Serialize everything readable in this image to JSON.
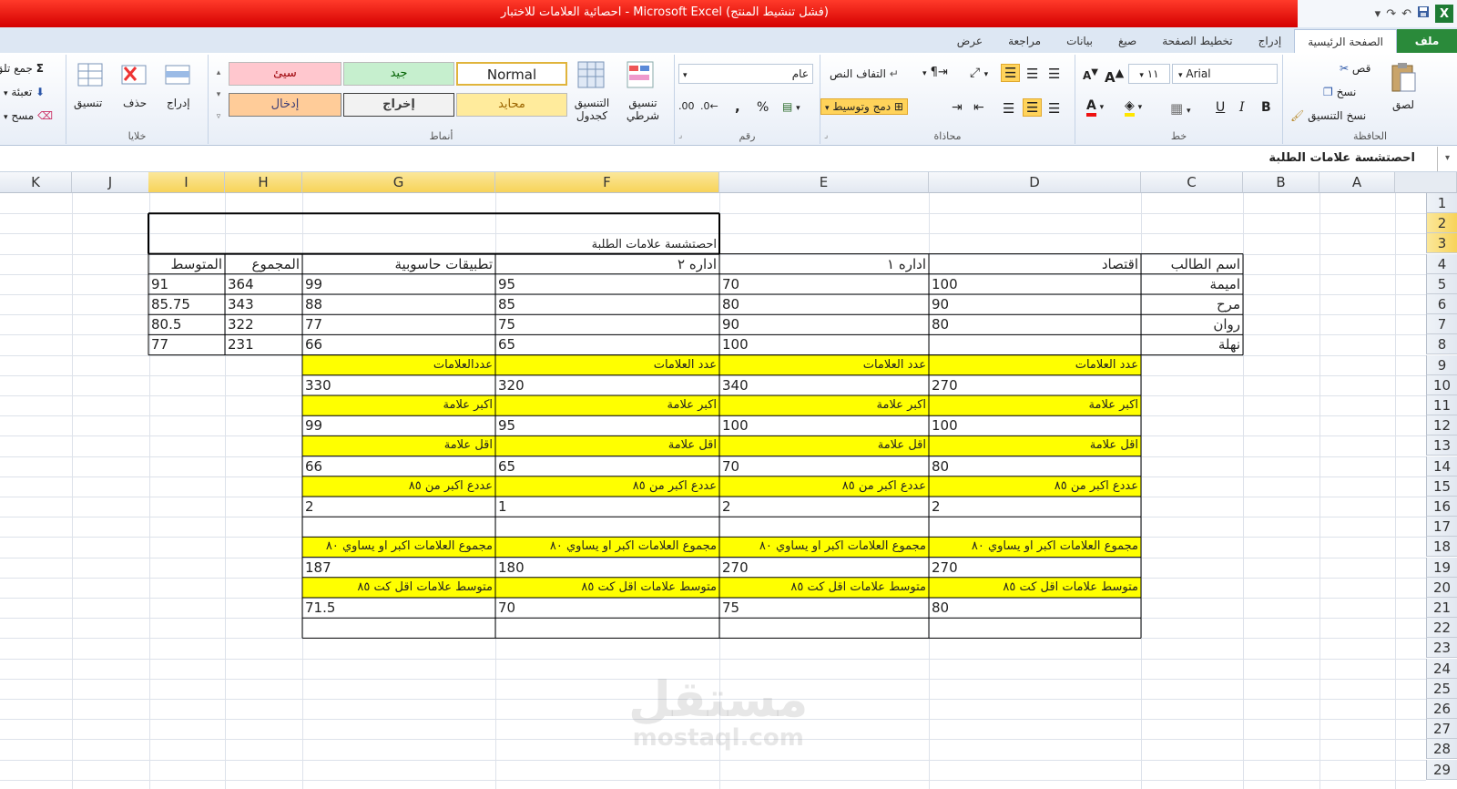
{
  "window": {
    "title": "احصائية العلامات للاختبار - Microsoft Excel (فشل تنشيط المنتج)",
    "qat_icons": [
      "excel-logo-icon",
      "save-icon",
      "undo-icon",
      "redo-icon",
      "customize-qat-icon"
    ]
  },
  "tabs": [
    {
      "label": "ملف"
    },
    {
      "label": "الصفحة الرئيسية"
    },
    {
      "label": "إدراج"
    },
    {
      "label": "تخطيط الصفحة"
    },
    {
      "label": "صيغ"
    },
    {
      "label": "بيانات"
    },
    {
      "label": "مراجعة"
    },
    {
      "label": "عرض"
    }
  ],
  "ribbon": {
    "clipboard": {
      "paste": "لصق",
      "cut": "قص",
      "copy": "نسخ",
      "format_painter": "نسخ التنسيق",
      "label": "الحافظة"
    },
    "font": {
      "name": "Arial",
      "size": "١١",
      "bold": "B",
      "italic": "I",
      "underline": "U",
      "grow": "A",
      "shrink": "A",
      "label": "خط"
    },
    "alignment": {
      "wrap": "التفاف النص",
      "merge": "دمج وتوسيط",
      "label": "محاذاة"
    },
    "number": {
      "format": "عام",
      "percent": "%",
      "comma": ",",
      "label": "رقم"
    },
    "styles": {
      "conditional": "تنسيق شرطي",
      "as_table": "التنسيق كجدول",
      "normal": "Normal",
      "good": "جيد",
      "bad": "سيئ",
      "neutral": "محايد",
      "output": "إخراج",
      "input": "إدخال",
      "label": "أنماط"
    },
    "cells": {
      "insert": "إدراج",
      "delete": "حذف",
      "format": "تنسيق",
      "label": "خلايا"
    },
    "editing": {
      "autosum": "جمع تلق",
      "fill": "تعبئة",
      "clear": "مسح"
    }
  },
  "formula_bar": {
    "content": "احصتشسة علامات الطلبة"
  },
  "columns": [
    "K",
    "J",
    "I",
    "H",
    "G",
    "F",
    "E",
    "D",
    "C",
    "B",
    "A"
  ],
  "rows": [
    "1",
    "2",
    "3",
    "4",
    "5",
    "6",
    "7",
    "8",
    "9",
    "10",
    "11",
    "12",
    "13",
    "14",
    "15",
    "16",
    "17",
    "18",
    "19",
    "20",
    "21",
    "22",
    "23",
    "24",
    "25",
    "26",
    "27",
    "28",
    "29"
  ],
  "sheet": {
    "title": "احصتشسة علامات الطلبة",
    "headers": {
      "student": "اسم الطالب",
      "econ": "اقتصاد",
      "admin1": "اداره ١",
      "admin2": "اداره ٢",
      "apps": "تطبيقات حاسوبية",
      "total": "المجموع",
      "avg": "المتوسط"
    },
    "students": [
      {
        "name": "اميمة",
        "econ": "100",
        "admin1": "70",
        "admin2": "95",
        "apps": "99",
        "total": "364",
        "avg": "91"
      },
      {
        "name": "مرح",
        "econ": "90",
        "admin1": "80",
        "admin2": "85",
        "apps": "88",
        "total": "343",
        "avg": "85.75"
      },
      {
        "name": "روان",
        "econ": "80",
        "admin1": "90",
        "admin2": "75",
        "apps": "77",
        "total": "322",
        "avg": "80.5"
      },
      {
        "name": "نهلة",
        "econ": "",
        "admin1": "100",
        "admin2": "65",
        "apps": "66",
        "total": "231",
        "avg": "77"
      }
    ],
    "stats": [
      {
        "labels": [
          "عدد العلامات",
          "عدد العلامات",
          "عدد العلامات",
          "عددالعلامات"
        ],
        "values": [
          "270",
          "340",
          "320",
          "330"
        ]
      },
      {
        "labels": [
          "اكبر علامة",
          "اكبر علامة",
          "اكبر علامة",
          "اكبر علامة"
        ],
        "values": [
          "100",
          "100",
          "95",
          "99"
        ]
      },
      {
        "labels": [
          "اقل علامة",
          "اقل علامة",
          "اقل علامة",
          "اقل علامة"
        ],
        "values": [
          "80",
          "70",
          "65",
          "66"
        ]
      },
      {
        "labels": [
          "عددع اكبر من ٨٥",
          "عددع اكبر من ٨٥",
          "عددع اكبر من ٨٥",
          "عددع اكبر من ٨٥"
        ],
        "values": [
          "2",
          "2",
          "1",
          "2"
        ]
      },
      {
        "labels": [
          "مجموع العلامات اكبر او يساوي ٨٠",
          "مجموع العلامات اكبر او يساوي ٨٠",
          "مجموع العلامات اكبر او يساوي ٨٠",
          "مجموع العلامات اكبر او يساوي ٨٠"
        ],
        "values": [
          "270",
          "270",
          "180",
          "187"
        ]
      },
      {
        "labels": [
          "متوسط علامات اقل كت ٨٥",
          "متوسط علامات اقل كت ٨٥",
          "متوسط علامات اقل كت ٨٥",
          "متوسط علامات اقل كت ٨٥"
        ],
        "values": [
          "80",
          "75",
          "70",
          "71.5"
        ]
      }
    ]
  },
  "watermark": {
    "arabic": "مستقل",
    "latin": "mostaql.com"
  }
}
